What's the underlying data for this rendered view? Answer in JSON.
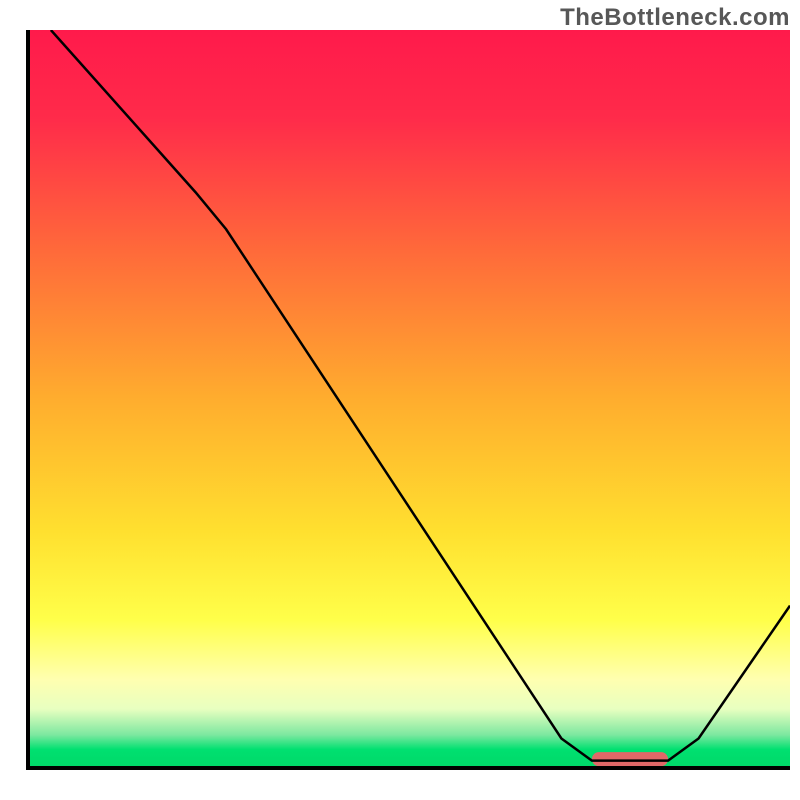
{
  "watermark": "TheBottleneck.com",
  "chart_data": {
    "type": "line",
    "title": "",
    "xlabel": "",
    "ylabel": "",
    "xlim": [
      0,
      100
    ],
    "ylim": [
      0,
      100
    ],
    "gradient_stops": [
      {
        "offset": 0.0,
        "color": "#ff1a4b"
      },
      {
        "offset": 0.12,
        "color": "#ff2b4a"
      },
      {
        "offset": 0.3,
        "color": "#ff6a3a"
      },
      {
        "offset": 0.5,
        "color": "#ffad2e"
      },
      {
        "offset": 0.68,
        "color": "#ffe02f"
      },
      {
        "offset": 0.8,
        "color": "#ffff4a"
      },
      {
        "offset": 0.88,
        "color": "#ffffb0"
      },
      {
        "offset": 0.92,
        "color": "#e8ffc0"
      },
      {
        "offset": 0.955,
        "color": "#7de8a0"
      },
      {
        "offset": 0.975,
        "color": "#00e070"
      },
      {
        "offset": 1.0,
        "color": "#00d868"
      }
    ],
    "series": [
      {
        "name": "bottleneck-curve",
        "points": [
          {
            "x": 3.0,
            "y": 100.0
          },
          {
            "x": 22.0,
            "y": 78.0
          },
          {
            "x": 26.0,
            "y": 73.0
          },
          {
            "x": 70.0,
            "y": 4.0
          },
          {
            "x": 74.0,
            "y": 1.0
          },
          {
            "x": 84.0,
            "y": 1.0
          },
          {
            "x": 88.0,
            "y": 4.0
          },
          {
            "x": 100.0,
            "y": 22.0
          }
        ]
      }
    ],
    "marker": {
      "x_start": 74.0,
      "x_end": 84.0,
      "y": 1.2,
      "color": "#e06868"
    },
    "frame": {
      "left": true,
      "bottom": true,
      "top": false,
      "right": false,
      "stroke": "#000000",
      "width": 4
    }
  }
}
